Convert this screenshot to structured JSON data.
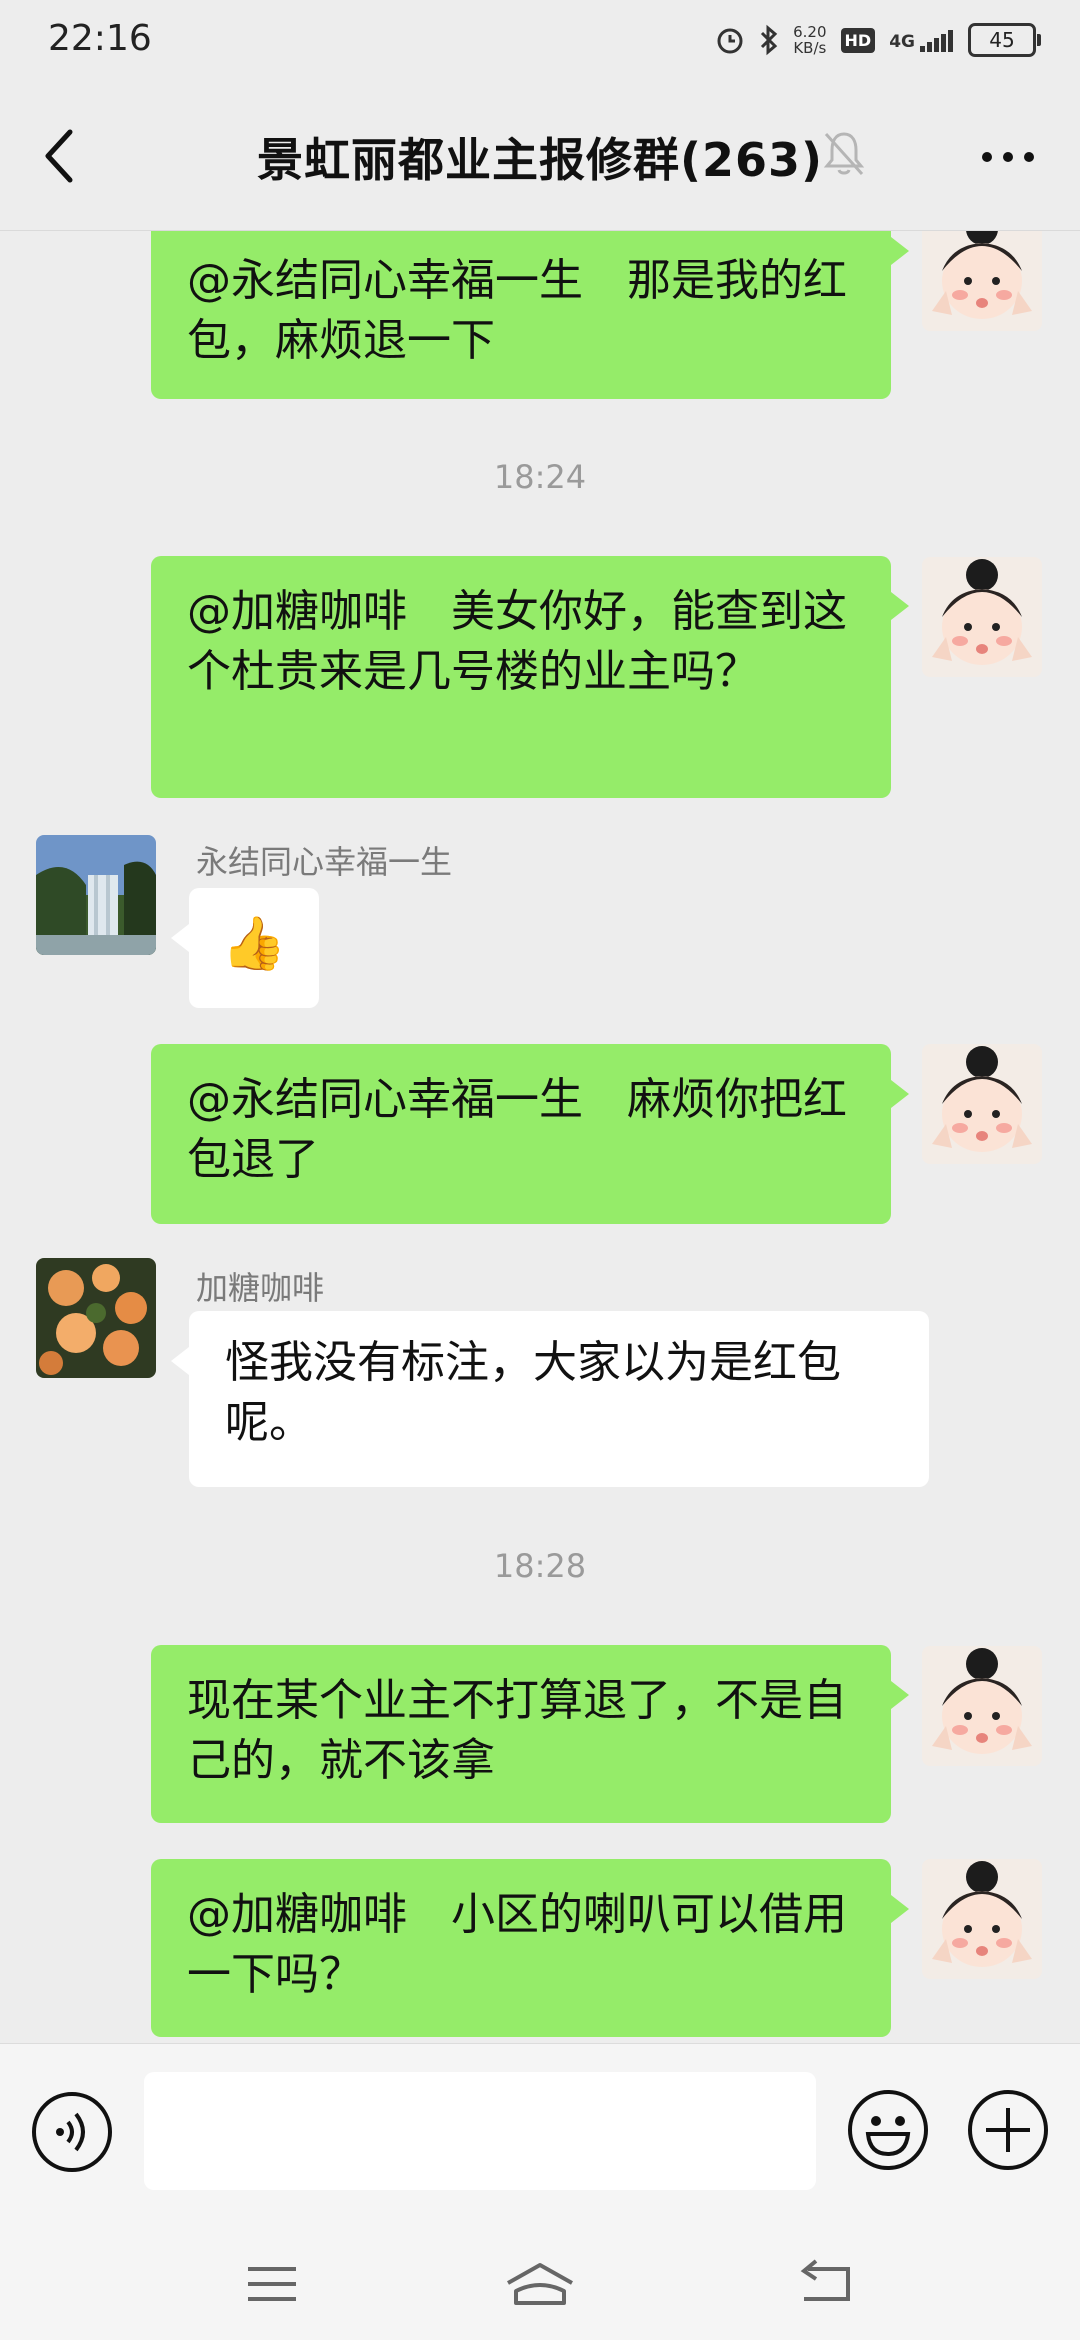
{
  "status_bar": {
    "time": "22:16",
    "net_speed_value": "6.20",
    "net_speed_unit": "KB/s",
    "hd_label": "HD",
    "network": "4G",
    "battery": "45"
  },
  "header": {
    "title": "景虹丽都业主报修群(263)"
  },
  "messages": {
    "m1": {
      "text": "@永结同心幸福一生　那是我的红包，麻烦退一下"
    },
    "t1": "18:24",
    "m2": {
      "text": "@加糖咖啡　美女你好，能查到这个杜贵来是几号楼的业主吗？"
    },
    "m3": {
      "sender": "永结同心幸福一生",
      "emoji": "👍"
    },
    "m4": {
      "text": "@永结同心幸福一生　麻烦你把红包退了"
    },
    "m5": {
      "sender": "加糖咖啡",
      "text": "怪我没有标注，大家以为是红包呢。"
    },
    "t2": "18:28",
    "m6": {
      "text": "现在某个业主不打算退了，不是自己的，就不该拿"
    },
    "m7": {
      "text": "@加糖咖啡　小区的喇叭可以借用一下吗？"
    }
  },
  "input": {
    "value": ""
  },
  "colors": {
    "outgoing_bubble": "#95ec69",
    "incoming_bubble": "#ffffff",
    "background": "#ededed"
  }
}
